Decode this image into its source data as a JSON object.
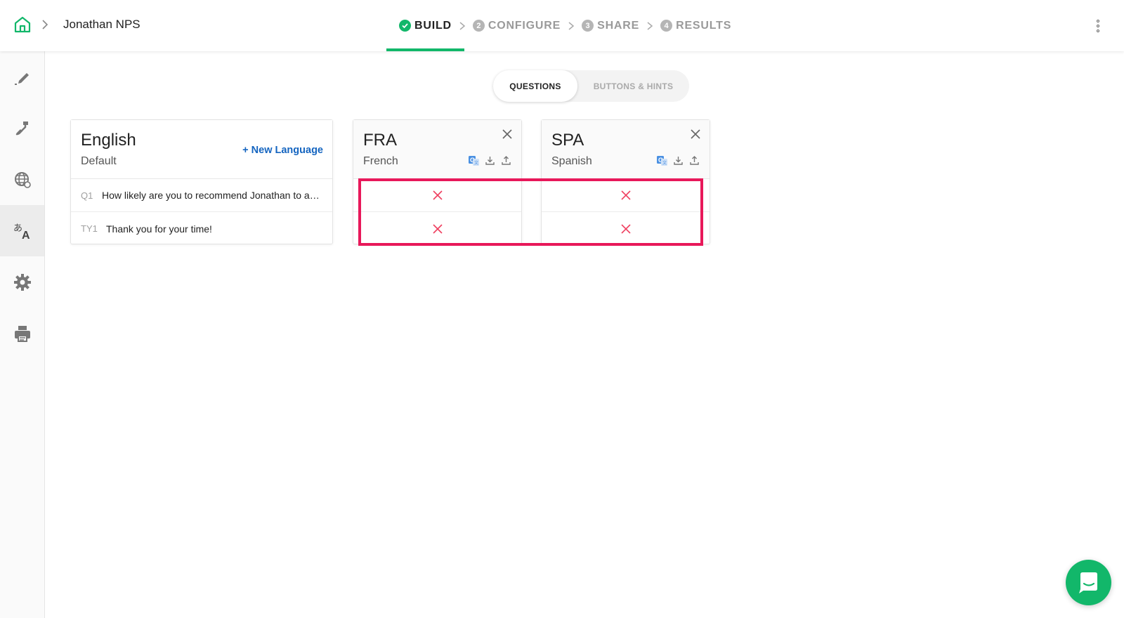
{
  "header": {
    "survey_name": "Jonathan NPS",
    "steps": [
      {
        "num": "",
        "label": "BUILD",
        "active": true
      },
      {
        "num": "2",
        "label": "CONFIGURE",
        "active": false
      },
      {
        "num": "3",
        "label": "SHARE",
        "active": false
      },
      {
        "num": "4",
        "label": "RESULTS",
        "active": false
      }
    ]
  },
  "sidebar": {
    "items": [
      {
        "icon": "pencil-icon",
        "active": false
      },
      {
        "icon": "paint-brush-icon",
        "active": false
      },
      {
        "icon": "globe-icon",
        "active": false
      },
      {
        "icon": "translate-icon",
        "active": true
      },
      {
        "icon": "gear-icon",
        "active": false
      },
      {
        "icon": "printer-icon",
        "active": false
      }
    ]
  },
  "tabs": {
    "questions": "QUESTIONS",
    "buttons_hints": "BUTTONS & HINTS"
  },
  "english": {
    "title": "English",
    "subtitle": "Default",
    "new_language": "+ New Language",
    "rows": [
      {
        "label": "Q1",
        "text": "How likely are you to recommend Jonathan to a…"
      },
      {
        "label": "TY1",
        "text": "Thank you for your time!"
      }
    ]
  },
  "languages": [
    {
      "code": "FRA",
      "name": "French",
      "rows": [
        "missing",
        "missing"
      ]
    },
    {
      "code": "SPA",
      "name": "Spanish",
      "rows": [
        "missing",
        "missing"
      ]
    }
  ],
  "colors": {
    "accent_green": "#12b76a",
    "link_blue": "#1565c0",
    "missing_red": "#ef4060",
    "highlight": "#e8185a"
  }
}
